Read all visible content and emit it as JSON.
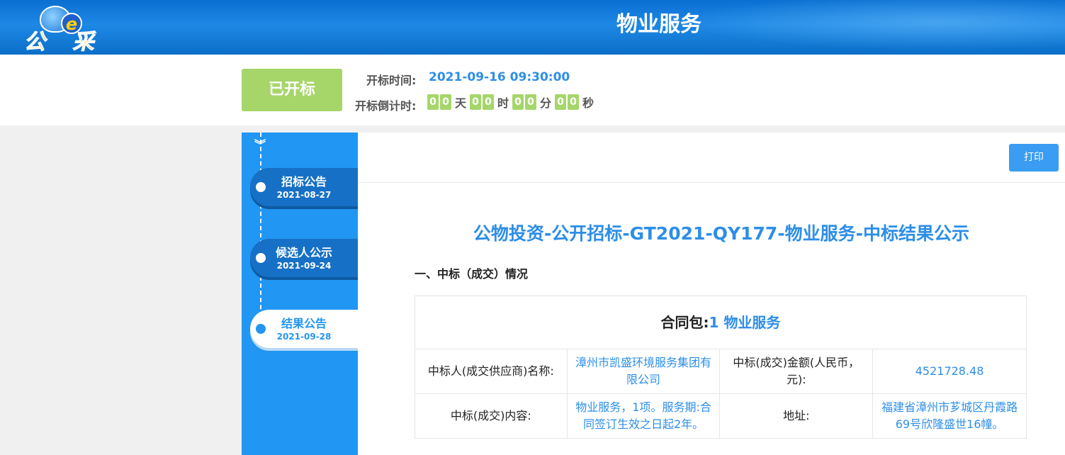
{
  "header": {
    "logo_text": "公e采",
    "logo_e": "e",
    "title": "物业服务"
  },
  "status": {
    "badge": "已开标",
    "open_time_label": "开标时间:",
    "open_time_value": "2021-09-16 09:30:00",
    "countdown_label": "开标倒计时:",
    "countdown": {
      "days": [
        "0",
        "0"
      ],
      "days_unit": "天",
      "hours": [
        "0",
        "0"
      ],
      "hours_unit": "时",
      "minutes": [
        "0",
        "0"
      ],
      "minutes_unit": "分",
      "seconds": [
        "0",
        "0"
      ],
      "seconds_unit": "秒"
    },
    "colors": {
      "badge": "#a6d66a",
      "accent": "#2d8ee8"
    }
  },
  "timeline": {
    "arrow_icon": "double-chevron-down-icon",
    "items": [
      {
        "title": "招标公告",
        "date": "2021-08-27",
        "active": false
      },
      {
        "title": "候选人公示",
        "date": "2021-09-24",
        "active": false
      },
      {
        "title": "结果公告",
        "date": "2021-09-28",
        "active": true
      }
    ]
  },
  "content": {
    "print_label": "打印",
    "notice_title": "公物投资-公开招标-GT2021-QY177-物业服务-中标结果公示",
    "section_heading": "一、中标（成交）情况",
    "package": {
      "prefix": "合同包:",
      "number": "1",
      "name": "物业服务"
    },
    "table": {
      "winner_label": "中标人(成交供应商)名称:",
      "winner_value": "漳州市凯盛环境服务集团有限公司",
      "amount_label": "中标(成交)金额(人民币，元):",
      "amount_value": "4521728.48",
      "content_label": "中标(成交)内容:",
      "content_value": "物业服务，1项。服务期:合同签订生效之日起2年。",
      "address_label": "地址:",
      "address_value": "福建省漳州市芗城区丹霞路69号欣隆盛世16幢。"
    }
  }
}
